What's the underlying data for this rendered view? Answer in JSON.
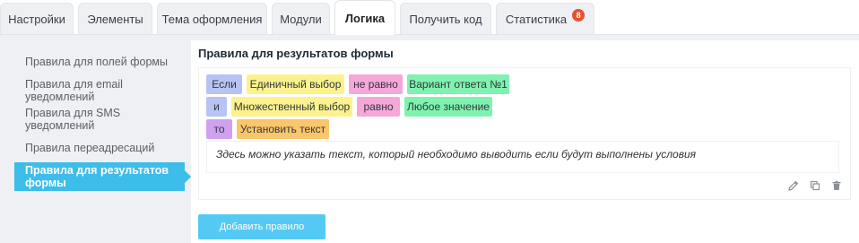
{
  "tabs": [
    {
      "label": "Настройки"
    },
    {
      "label": "Элементы"
    },
    {
      "label": "Тема оформления"
    },
    {
      "label": "Модули"
    },
    {
      "label": "Логика"
    },
    {
      "label": "Получить код"
    },
    {
      "label": "Статистика",
      "badge": "8"
    }
  ],
  "active_tab": "Логика",
  "sidebar": {
    "items": [
      {
        "label": "Правила для полей формы"
      },
      {
        "label": "Правила для email уведомлений"
      },
      {
        "label": "Правила для SMS уведомлений"
      },
      {
        "label": "Правила переадресаций"
      },
      {
        "label": "Правила для результатов формы"
      }
    ],
    "active_item": "Правила для результатов формы"
  },
  "main": {
    "title": "Правила для результатов формы",
    "rule": {
      "row1": {
        "if": "Если",
        "field": "Единичный выбор",
        "operator": "не равно",
        "value": "Вариант ответа №1"
      },
      "row2": {
        "and": "и",
        "field": "Множественный выбор",
        "operator": "равно",
        "value": "Любое значение"
      },
      "row3": {
        "then": "то",
        "action": "Установить текст"
      },
      "text": "Здесь можно указать текст, который необходимо выводить если будут выполнены условия"
    },
    "add_rule_label": "Добавить правило"
  },
  "colors": {
    "accent": "#3dbde9",
    "button": "#54c9f4",
    "badge": "#e8512b",
    "chip_condition": "#b7c3f3",
    "chip_field": "#fbf28d",
    "chip_operator": "#f6a7d8",
    "chip_value": "#7ff2b0",
    "chip_then": "#cfa1f0",
    "chip_action": "#f9c66b"
  },
  "icons": {
    "edit": "pencil-icon",
    "copy": "copy-icon",
    "delete": "trash-icon"
  }
}
